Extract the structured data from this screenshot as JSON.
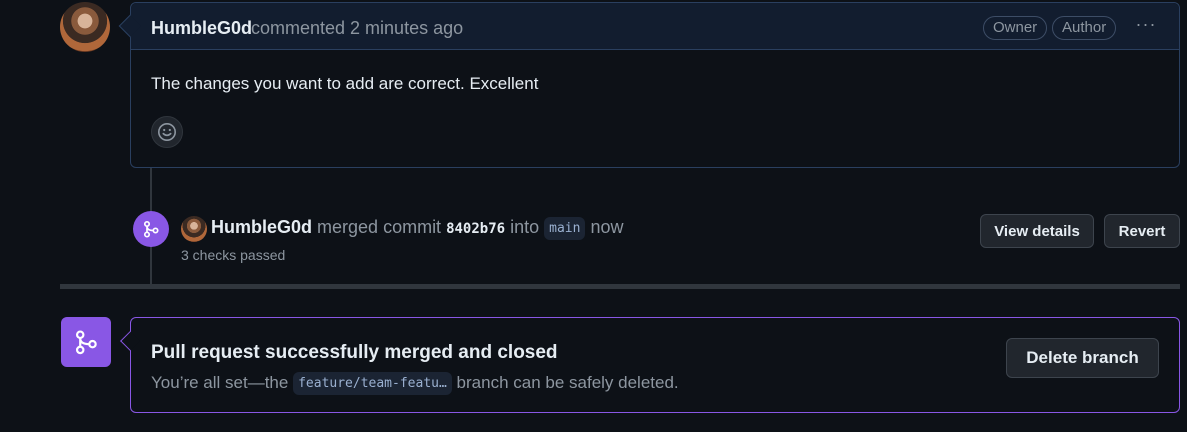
{
  "comment": {
    "author": "HumbleG0d",
    "meta": "commented 2 minutes ago",
    "badges": [
      "Owner",
      "Author"
    ],
    "menu_glyph": "···",
    "body": "The changes you want to add are correct. Excellent"
  },
  "merge_event": {
    "actor": "HumbleG0d",
    "verb": "merged commit",
    "sha": "8402b76",
    "into": "into",
    "branch": "main",
    "when": "now",
    "checks": "3 checks passed",
    "view_details_label": "View details",
    "revert_label": "Revert"
  },
  "merged": {
    "title": "Pull request successfully merged and closed",
    "sub_prefix": "You’re all set—the",
    "branch": "feature/team-featu…",
    "sub_suffix": "branch can be safely deleted.",
    "delete_label": "Delete branch"
  },
  "colors": {
    "background": "#0d1117",
    "merged_purple": "#8957e5",
    "header_bg": "#121d2f"
  },
  "icons": {
    "avatar": "avatar",
    "smiley": "smiley-icon",
    "merge": "git-merge-icon",
    "kebab": "kebab-horizontal-icon"
  }
}
